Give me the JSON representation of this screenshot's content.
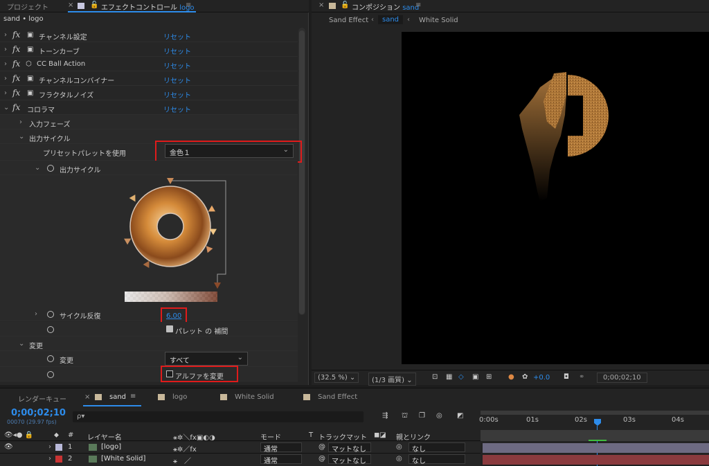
{
  "effects_panel": {
    "tab_project": "プロジェクト",
    "tab_effect_controls": "エフェクトコントロール",
    "tab_effect_layer": "logo",
    "breadcrumb": "sand • logo",
    "effects": [
      {
        "name": "チャンネル設定",
        "reset": "リセット"
      },
      {
        "name": "トーンカーブ",
        "reset": "リセット"
      },
      {
        "name": "CC Ball Action",
        "reset": "リセット"
      },
      {
        "name": "チャンネルコンバイナー",
        "reset": "リセット"
      },
      {
        "name": "フラクタルノイズ",
        "reset": "リセット"
      },
      {
        "name": "コロラマ",
        "reset": "リセット"
      }
    ],
    "input_phase": "入力フェーズ",
    "output_cycle_group": "出力サイクル",
    "use_preset_palette_label": "プリセットパレットを使用",
    "use_preset_palette_value": "金色１",
    "output_cycle_label": "出力サイクル",
    "cycle_repeat_label": "サイクル反復",
    "cycle_repeat_value": "6.00",
    "interpolate_palette_label": "パレット の 補間",
    "modify_group": "変更",
    "modify_label": "変更",
    "modify_value": "すべて",
    "modify_alpha_label": "アルファを変更"
  },
  "comp_panel": {
    "tab_label": "コンポジション",
    "comp_name": "sand",
    "breadcrumbs": [
      "Sand Effect",
      "sand",
      "White Solid"
    ],
    "zoom": "(32.5 %)",
    "resolution": "(1/3 画質)",
    "exposure": "+0.0",
    "timecode": "0;00;02;10"
  },
  "timeline": {
    "tab_render_queue": "レンダーキュー",
    "tabs": [
      "sand",
      "logo",
      "White Solid",
      "Sand Effect"
    ],
    "timecode": "0;00;02;10",
    "frame_info": "00070 (29.97 fps)",
    "search_placeholder": "ρ▾",
    "col_num": "#",
    "col_layer_name": "レイヤー名",
    "col_mode": "モード",
    "col_t": "T",
    "col_track_matte": "トラックマット",
    "col_parent": "親とリンク",
    "ruler_labels": [
      "0:00s",
      "01s",
      "02s",
      "03s",
      "04s"
    ],
    "layers": [
      {
        "num": "1",
        "name": "[logo]",
        "mode": "通常",
        "matte": "マットなし",
        "parent": "なし",
        "color": "#b8b8d8"
      },
      {
        "num": "2",
        "name": "[White Solid]",
        "mode": "通常",
        "matte": "マットなし",
        "parent": "なし",
        "color": "#c93333"
      }
    ]
  }
}
